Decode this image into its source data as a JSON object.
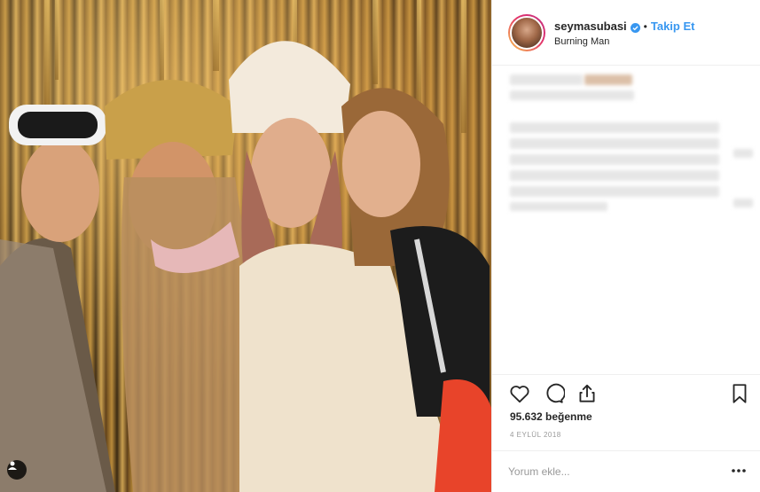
{
  "post": {
    "username": "seymasubasi",
    "follow_label": "Takip Et",
    "separator": "•",
    "location": "Burning Man",
    "likes": "95.632 beğenme",
    "date": "4 Eylül 2018"
  },
  "comment": {
    "placeholder": "Yorum ekle..."
  },
  "colors": {
    "link": "#3897f0",
    "verified": "#3897f0",
    "border": "#efefef"
  },
  "icons": [
    "tag-user-icon",
    "heart-icon",
    "comment-icon",
    "share-icon",
    "bookmark-icon",
    "more-options-icon",
    "verified-badge-icon"
  ]
}
